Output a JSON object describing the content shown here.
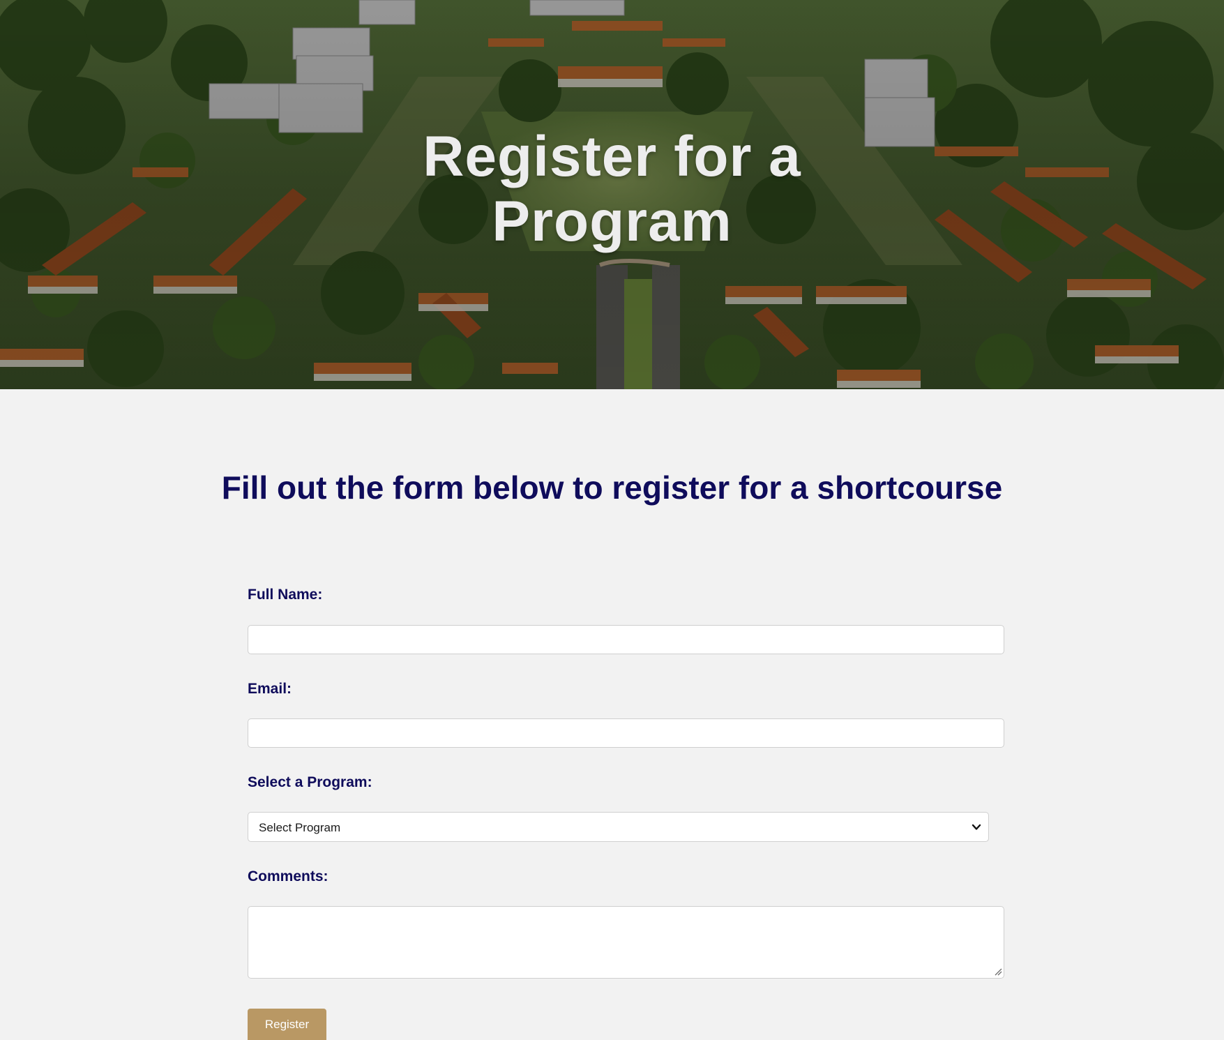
{
  "hero": {
    "title_line1": "Register for a",
    "title_line2": "Program",
    "background": "aerial-campus-photo"
  },
  "intro": {
    "heading": "Fill out the form below to register for a shortcourse"
  },
  "form": {
    "full_name": {
      "label": "Full Name:",
      "value": "",
      "placeholder": ""
    },
    "email": {
      "label": "Email:",
      "value": "",
      "placeholder": ""
    },
    "program": {
      "label": "Select a Program:",
      "selected": "Select Program",
      "icon": "chevron-down-icon"
    },
    "comments": {
      "label": "Comments:",
      "value": ""
    },
    "submit_label": "Register"
  },
  "colors": {
    "page_bg": "#f2f2f2",
    "heading_navy": "#0f0c5b",
    "button_gold": "#b99864",
    "hero_text": "#ededed"
  }
}
